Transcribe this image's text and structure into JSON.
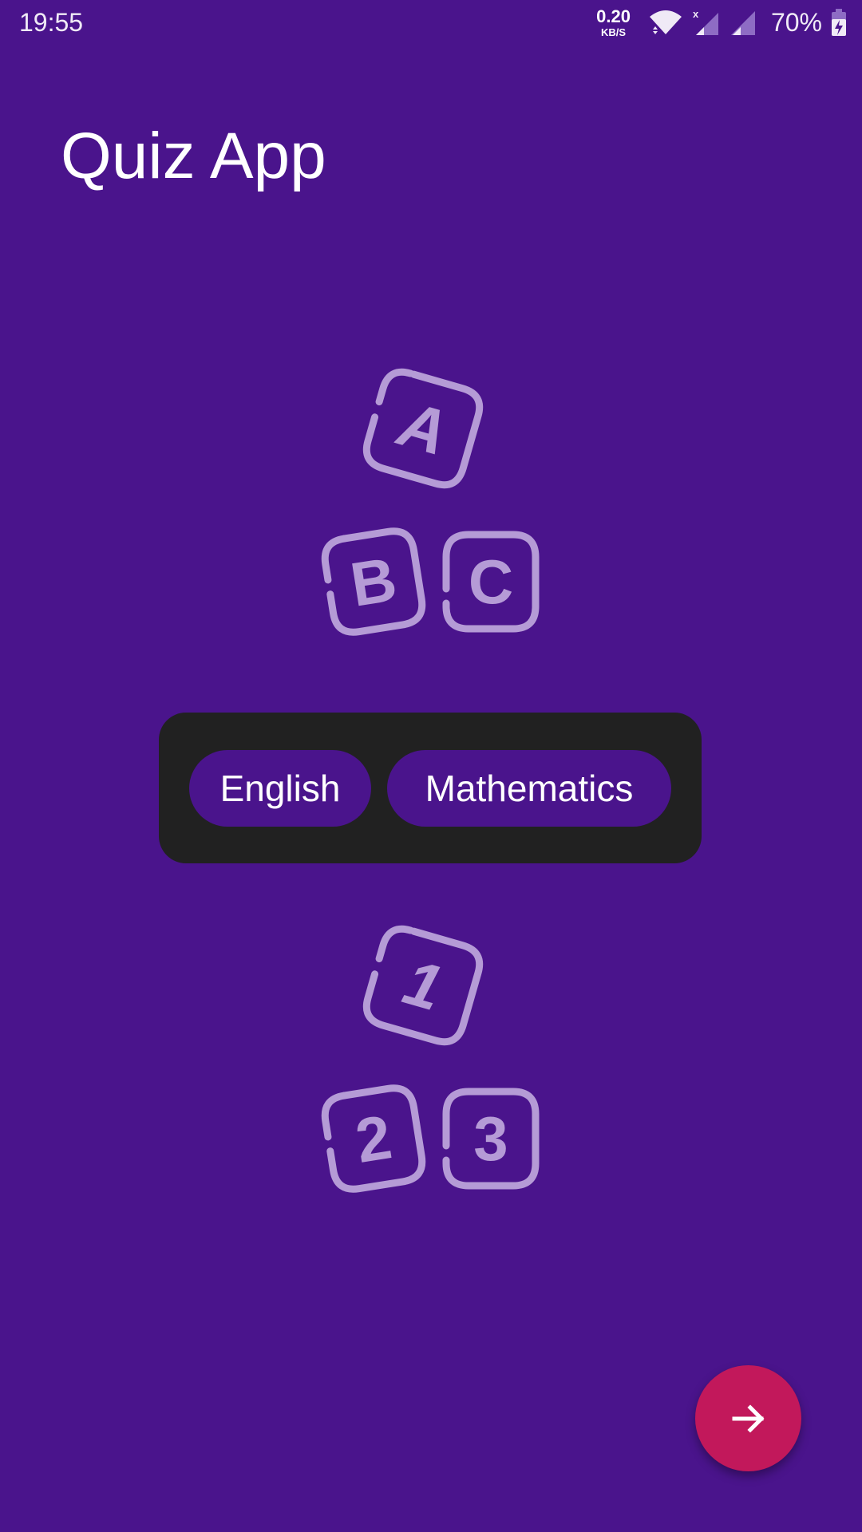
{
  "status_bar": {
    "time": "19:55",
    "net_speed_value": "0.20",
    "net_speed_unit": "KB/S",
    "battery": "70%",
    "icons": [
      "wifi-icon",
      "signal-icon",
      "signal-icon",
      "battery-charging-icon"
    ]
  },
  "app": {
    "title": "Quiz App"
  },
  "illustrations": {
    "letters": {
      "top": "A",
      "left": "B",
      "right": "C",
      "icon": "letter-blocks-icon"
    },
    "numbers": {
      "top": "1",
      "left": "2",
      "right": "3",
      "icon": "number-blocks-icon"
    }
  },
  "subjects": {
    "english_label": "English",
    "math_label": "Mathematics"
  },
  "fab": {
    "icon": "arrow-right-icon"
  },
  "colors": {
    "background": "#4a148c",
    "panel": "#212121",
    "chip": "#4a148c",
    "fab": "#c2185b",
    "block_stroke": "#b59bd6"
  }
}
